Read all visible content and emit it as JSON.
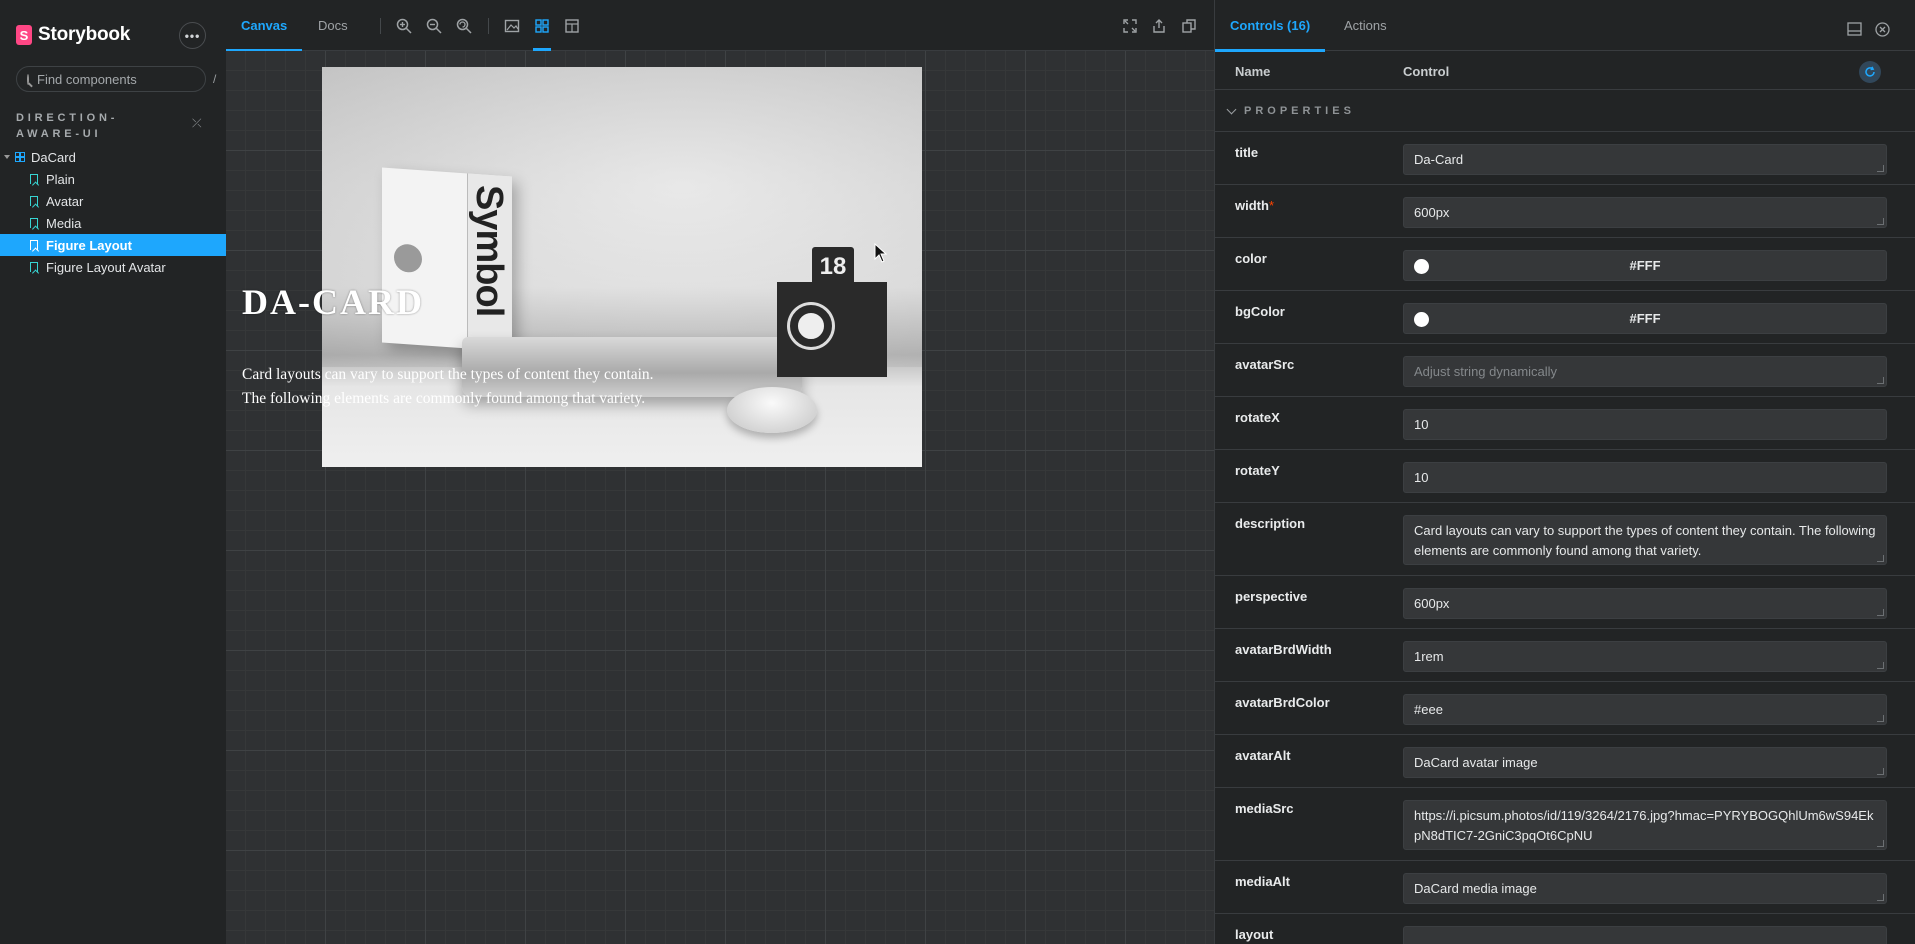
{
  "sidebar": {
    "brand": "Storybook",
    "search_placeholder": "Find components",
    "search_shortcut": "/",
    "group_title": "DIRECTION-AWARE-UI",
    "component": "DaCard",
    "stories": [
      "Plain",
      "Avatar",
      "Media",
      "Figure Layout",
      "Figure Layout Avatar"
    ],
    "selected_story": "Figure Layout"
  },
  "toolbar": {
    "tabs": [
      "Canvas",
      "Docs"
    ],
    "active_tab": "Canvas"
  },
  "preview": {
    "title": "DA-CARD",
    "description": "Card layouts can vary to support the types of content they contain. The following elements are commonly found among that variety.",
    "media_badge": "18",
    "book_text": "Symbol"
  },
  "panel": {
    "tabs": [
      "Controls (16)",
      "Actions"
    ],
    "active_tab": "Controls (16)",
    "col_name": "Name",
    "col_control": "Control",
    "section": "PROPERTIES",
    "controls": [
      {
        "name": "title",
        "value": "Da-Card",
        "type": "text"
      },
      {
        "name": "width",
        "value": "600px",
        "type": "text",
        "required": "*"
      },
      {
        "name": "color",
        "value": "#FFF",
        "type": "color"
      },
      {
        "name": "bgColor",
        "value": "#FFF",
        "type": "color"
      },
      {
        "name": "avatarSrc",
        "value": "",
        "placeholder": "Adjust string dynamically",
        "type": "text"
      },
      {
        "name": "rotateX",
        "value": "10",
        "type": "number"
      },
      {
        "name": "rotateY",
        "value": "10",
        "type": "number"
      },
      {
        "name": "description",
        "value": "Card layouts can vary to support the types of content they contain. The following elements are commonly found among that variety.",
        "type": "textarea"
      },
      {
        "name": "perspective",
        "value": "600px",
        "type": "text"
      },
      {
        "name": "avatarBrdWidth",
        "value": "1rem",
        "type": "text"
      },
      {
        "name": "avatarBrdColor",
        "value": "#eee",
        "type": "text"
      },
      {
        "name": "avatarAlt",
        "value": "DaCard avatar image",
        "type": "text"
      },
      {
        "name": "mediaSrc",
        "value": "https://i.picsum.photos/id/119/3264/2176.jpg?hmac=PYRYBOGQhlUm6wS94EkpN8dTIC7-2GniC3pqOt6CpNU",
        "type": "textarea"
      },
      {
        "name": "mediaAlt",
        "value": "DaCard media image",
        "type": "text"
      },
      {
        "name": "layout",
        "value": "",
        "type": "text"
      }
    ]
  },
  "colors": {
    "accent": "#1ea7fd",
    "brand": "#ff4785",
    "background": "#222425",
    "canvas": "#2f3133"
  }
}
